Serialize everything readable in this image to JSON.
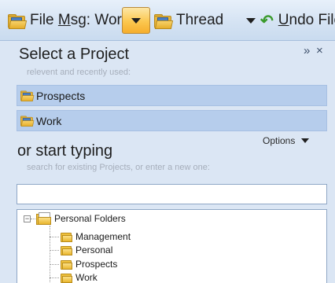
{
  "toolbar": {
    "file_msg_prefix": "File ",
    "file_msg_mnemonic": "M",
    "file_msg_suffix": "sg: Work",
    "thread_label": "Thread",
    "undo_mnemonic": "U",
    "undo_suffix": "ndo File"
  },
  "panel": {
    "title": "Select a Project",
    "subtitle": "relevent and recently used:",
    "expand_glyph": "»",
    "close_glyph": "×",
    "projects": [
      {
        "label": "Prospects"
      },
      {
        "label": "Work"
      }
    ],
    "search_title": "or start typing",
    "search_subtitle": "search for existing Projects, or enter a new one:",
    "options_label": "Options",
    "search_value": ""
  },
  "tree": {
    "expander_glyph": "−",
    "root": "Personal Folders",
    "children": [
      "Management",
      "Personal",
      "Prospects",
      "Work"
    ]
  },
  "colors": {
    "accent_orange": "#fbc74f",
    "selection_blue": "#b6cdec",
    "panel_bg": "#dbe6f4"
  },
  "icons": [
    "project-folder-icon",
    "dropdown-arrow-icon",
    "undo-icon",
    "expand-icon",
    "close-icon",
    "folder-icon"
  ]
}
